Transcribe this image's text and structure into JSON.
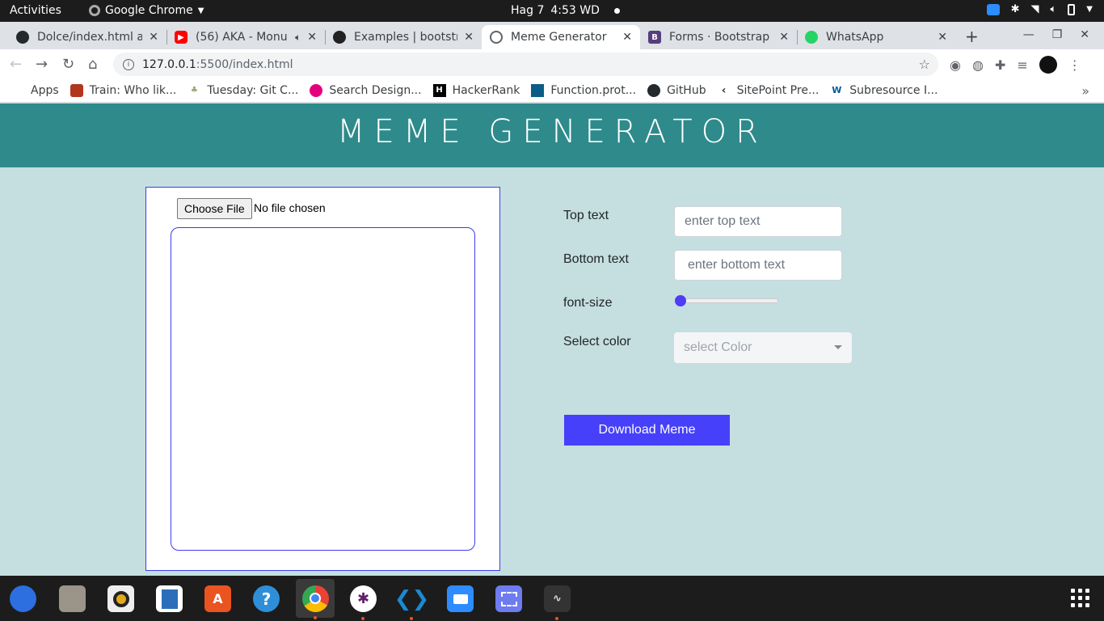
{
  "system": {
    "activities": "Activities",
    "app_name": "Google Chrome",
    "date": "Hag 7",
    "time": "4:53 WD"
  },
  "tabs": [
    {
      "title": "Dolce/index.html a",
      "icon": "github-icon",
      "color": "#24292e"
    },
    {
      "title": "(56) AKA - Monu",
      "icon": "youtube-icon",
      "color": "#ff0000"
    },
    {
      "title": "Examples | bootstr",
      "icon": "bootstrap-icon",
      "color": "#222"
    },
    {
      "title": "Meme Generator",
      "icon": "globe-icon",
      "color": "#5f6368"
    },
    {
      "title": "Forms · Bootstrap",
      "icon": "bootstrap-icon",
      "color": "#563d7c"
    },
    {
      "title": "WhatsApp",
      "icon": "whatsapp-icon",
      "color": "#25d366"
    }
  ],
  "address": {
    "host": "127.0.0.1",
    "path": ":5500/index.html"
  },
  "bookmarks": [
    {
      "label": "Apps",
      "icon": "apps-grid-icon",
      "color": "#4285f4"
    },
    {
      "label": "Train: Who lik...",
      "icon": "codewars-icon",
      "color": "#b1361e"
    },
    {
      "label": "Tuesday: Git C...",
      "icon": "tree-icon",
      "color": "#9aa77b"
    },
    {
      "label": "Search Design...",
      "icon": "dribbble-icon",
      "color": "#e4007c"
    },
    {
      "label": "HackerRank",
      "icon": "hackerrank-icon",
      "color": "#000"
    },
    {
      "label": "Function.prot...",
      "icon": "mdn-icon",
      "color": "#0b5d87"
    },
    {
      "label": "GitHub",
      "icon": "github-icon",
      "color": "#24292e"
    },
    {
      "label": "SitePoint Pre...",
      "icon": "sitepoint-icon",
      "color": "#333"
    },
    {
      "label": "Subresource I...",
      "icon": "w3c-icon",
      "color": "#005a9c"
    }
  ],
  "page": {
    "title": "MEME GENERATOR",
    "file_button": "Choose File",
    "file_status": "No file chosen",
    "top_label": "Top text",
    "top_placeholder": "enter top text",
    "bottom_label": "Bottom text",
    "bottom_placeholder": "enter bottom text",
    "font_label": "font-size",
    "font_size_level": 0,
    "color_label": "Select color",
    "color_placeholder": "select Color",
    "download": "Download Meme"
  },
  "colors": {
    "header": "#2e8a8b",
    "background": "#c5dfe0",
    "accent": "#4640fa"
  },
  "dock": [
    "thunderbird-icon",
    "files-icon",
    "rhythmbox-icon",
    "writer-icon",
    "software-icon",
    "help-icon",
    "chrome-icon",
    "slack-icon",
    "vscode-icon",
    "zoom-icon",
    "screenshot-icon",
    "monitor-icon"
  ]
}
